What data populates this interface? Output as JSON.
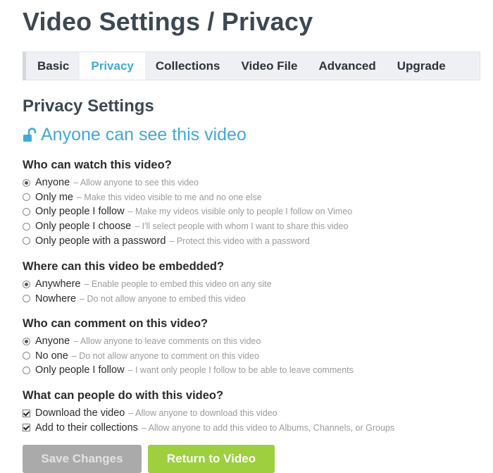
{
  "page": {
    "title": "Video Settings / Privacy"
  },
  "tabs": [
    {
      "label": "Basic"
    },
    {
      "label": "Privacy"
    },
    {
      "label": "Collections"
    },
    {
      "label": "Video File"
    },
    {
      "label": "Advanced"
    },
    {
      "label": "Upgrade"
    }
  ],
  "active_tab": "Privacy",
  "section_title": "Privacy Settings",
  "status_text": "Anyone can see this video",
  "watch": {
    "question": "Who can watch this video?",
    "options": [
      {
        "label": "Anyone",
        "desc": "– Allow anyone to see this video",
        "selected": true
      },
      {
        "label": "Only me",
        "desc": "– Make this video visible to me and no one else",
        "selected": false
      },
      {
        "label": "Only people I follow",
        "desc": "– Make my videos visible only to people I follow on Vimeo",
        "selected": false
      },
      {
        "label": "Only people I choose",
        "desc": "– I'll select people with whom I want to share this video",
        "selected": false
      },
      {
        "label": "Only people with a password",
        "desc": "– Protect this video with a password",
        "selected": false
      }
    ]
  },
  "embed": {
    "question": "Where can this video be embedded?",
    "options": [
      {
        "label": "Anywhere",
        "desc": "– Enable people to embed this video on any site",
        "selected": true
      },
      {
        "label": "Nowhere",
        "desc": "– Do not allow anyone to embed this video",
        "selected": false
      }
    ]
  },
  "comment": {
    "question": "Who can comment on this video?",
    "options": [
      {
        "label": "Anyone",
        "desc": "– Allow anyone to leave comments on this video",
        "selected": true
      },
      {
        "label": "No one",
        "desc": "– Do not allow anyone to comment on this video",
        "selected": false
      },
      {
        "label": "Only people I follow",
        "desc": "– I want only people I follow to be able to leave comments",
        "selected": false
      }
    ]
  },
  "actions": {
    "question": "What can people do with this video?",
    "options": [
      {
        "label": "Download the video",
        "desc": "– Allow anyone to download this video",
        "checked": true
      },
      {
        "label": "Add to their collections",
        "desc": "– Allow anyone to add this video to Albums, Channels, or Groups",
        "checked": true
      }
    ]
  },
  "buttons": {
    "save": "Save Changes",
    "return": "Return to Video"
  },
  "colors": {
    "accent": "#41a9d6",
    "title": "#3c4852",
    "save_disabled": "#aaaaaa",
    "return_green": "#9dcf3f"
  }
}
